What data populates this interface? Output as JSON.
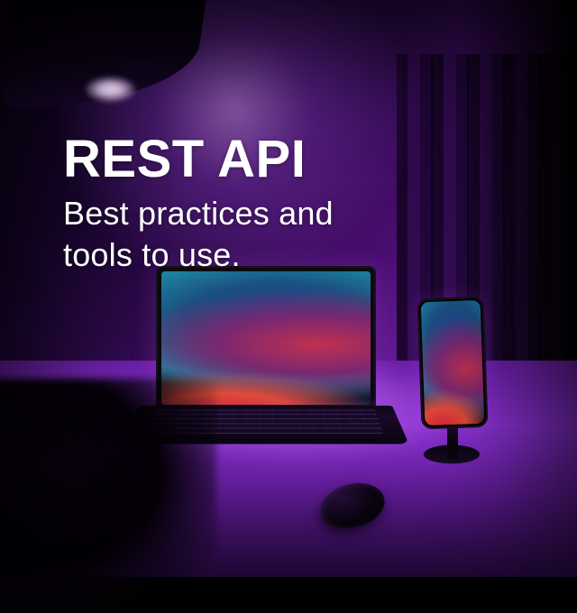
{
  "title": "REST API",
  "subtitle": "Best practices and tools to use."
}
